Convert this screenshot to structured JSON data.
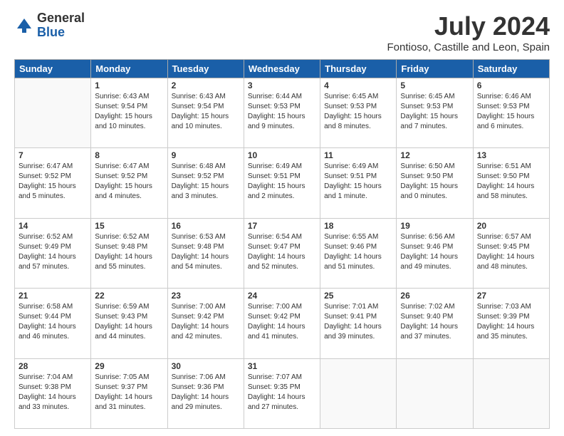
{
  "logo": {
    "general": "General",
    "blue": "Blue"
  },
  "header": {
    "title": "July 2024",
    "subtitle": "Fontioso, Castille and Leon, Spain"
  },
  "columns": [
    "Sunday",
    "Monday",
    "Tuesday",
    "Wednesday",
    "Thursday",
    "Friday",
    "Saturday"
  ],
  "weeks": [
    [
      {
        "day": "",
        "content": ""
      },
      {
        "day": "1",
        "content": "Sunrise: 6:43 AM\nSunset: 9:54 PM\nDaylight: 15 hours\nand 10 minutes."
      },
      {
        "day": "2",
        "content": "Sunrise: 6:43 AM\nSunset: 9:54 PM\nDaylight: 15 hours\nand 10 minutes."
      },
      {
        "day": "3",
        "content": "Sunrise: 6:44 AM\nSunset: 9:53 PM\nDaylight: 15 hours\nand 9 minutes."
      },
      {
        "day": "4",
        "content": "Sunrise: 6:45 AM\nSunset: 9:53 PM\nDaylight: 15 hours\nand 8 minutes."
      },
      {
        "day": "5",
        "content": "Sunrise: 6:45 AM\nSunset: 9:53 PM\nDaylight: 15 hours\nand 7 minutes."
      },
      {
        "day": "6",
        "content": "Sunrise: 6:46 AM\nSunset: 9:53 PM\nDaylight: 15 hours\nand 6 minutes."
      }
    ],
    [
      {
        "day": "7",
        "content": "Sunrise: 6:47 AM\nSunset: 9:52 PM\nDaylight: 15 hours\nand 5 minutes."
      },
      {
        "day": "8",
        "content": "Sunrise: 6:47 AM\nSunset: 9:52 PM\nDaylight: 15 hours\nand 4 minutes."
      },
      {
        "day": "9",
        "content": "Sunrise: 6:48 AM\nSunset: 9:52 PM\nDaylight: 15 hours\nand 3 minutes."
      },
      {
        "day": "10",
        "content": "Sunrise: 6:49 AM\nSunset: 9:51 PM\nDaylight: 15 hours\nand 2 minutes."
      },
      {
        "day": "11",
        "content": "Sunrise: 6:49 AM\nSunset: 9:51 PM\nDaylight: 15 hours\nand 1 minute."
      },
      {
        "day": "12",
        "content": "Sunrise: 6:50 AM\nSunset: 9:50 PM\nDaylight: 15 hours\nand 0 minutes."
      },
      {
        "day": "13",
        "content": "Sunrise: 6:51 AM\nSunset: 9:50 PM\nDaylight: 14 hours\nand 58 minutes."
      }
    ],
    [
      {
        "day": "14",
        "content": "Sunrise: 6:52 AM\nSunset: 9:49 PM\nDaylight: 14 hours\nand 57 minutes."
      },
      {
        "day": "15",
        "content": "Sunrise: 6:52 AM\nSunset: 9:48 PM\nDaylight: 14 hours\nand 55 minutes."
      },
      {
        "day": "16",
        "content": "Sunrise: 6:53 AM\nSunset: 9:48 PM\nDaylight: 14 hours\nand 54 minutes."
      },
      {
        "day": "17",
        "content": "Sunrise: 6:54 AM\nSunset: 9:47 PM\nDaylight: 14 hours\nand 52 minutes."
      },
      {
        "day": "18",
        "content": "Sunrise: 6:55 AM\nSunset: 9:46 PM\nDaylight: 14 hours\nand 51 minutes."
      },
      {
        "day": "19",
        "content": "Sunrise: 6:56 AM\nSunset: 9:46 PM\nDaylight: 14 hours\nand 49 minutes."
      },
      {
        "day": "20",
        "content": "Sunrise: 6:57 AM\nSunset: 9:45 PM\nDaylight: 14 hours\nand 48 minutes."
      }
    ],
    [
      {
        "day": "21",
        "content": "Sunrise: 6:58 AM\nSunset: 9:44 PM\nDaylight: 14 hours\nand 46 minutes."
      },
      {
        "day": "22",
        "content": "Sunrise: 6:59 AM\nSunset: 9:43 PM\nDaylight: 14 hours\nand 44 minutes."
      },
      {
        "day": "23",
        "content": "Sunrise: 7:00 AM\nSunset: 9:42 PM\nDaylight: 14 hours\nand 42 minutes."
      },
      {
        "day": "24",
        "content": "Sunrise: 7:00 AM\nSunset: 9:42 PM\nDaylight: 14 hours\nand 41 minutes."
      },
      {
        "day": "25",
        "content": "Sunrise: 7:01 AM\nSunset: 9:41 PM\nDaylight: 14 hours\nand 39 minutes."
      },
      {
        "day": "26",
        "content": "Sunrise: 7:02 AM\nSunset: 9:40 PM\nDaylight: 14 hours\nand 37 minutes."
      },
      {
        "day": "27",
        "content": "Sunrise: 7:03 AM\nSunset: 9:39 PM\nDaylight: 14 hours\nand 35 minutes."
      }
    ],
    [
      {
        "day": "28",
        "content": "Sunrise: 7:04 AM\nSunset: 9:38 PM\nDaylight: 14 hours\nand 33 minutes."
      },
      {
        "day": "29",
        "content": "Sunrise: 7:05 AM\nSunset: 9:37 PM\nDaylight: 14 hours\nand 31 minutes."
      },
      {
        "day": "30",
        "content": "Sunrise: 7:06 AM\nSunset: 9:36 PM\nDaylight: 14 hours\nand 29 minutes."
      },
      {
        "day": "31",
        "content": "Sunrise: 7:07 AM\nSunset: 9:35 PM\nDaylight: 14 hours\nand 27 minutes."
      },
      {
        "day": "",
        "content": ""
      },
      {
        "day": "",
        "content": ""
      },
      {
        "day": "",
        "content": ""
      }
    ]
  ]
}
